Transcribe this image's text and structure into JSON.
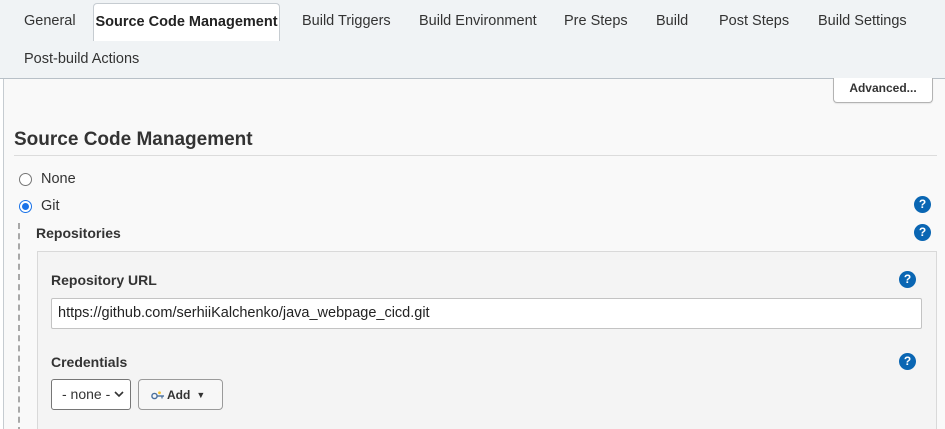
{
  "tabs": [
    {
      "label": "General",
      "active": false
    },
    {
      "label": "Source Code Management",
      "active": true
    },
    {
      "label": "Build Triggers",
      "active": false
    },
    {
      "label": "Build Environment",
      "active": false
    },
    {
      "label": "Pre Steps",
      "active": false
    },
    {
      "label": "Build",
      "active": false
    },
    {
      "label": "Post Steps",
      "active": false
    },
    {
      "label": "Build Settings",
      "active": false
    },
    {
      "label": "Post-build Actions",
      "active": false
    }
  ],
  "advanced_label": "Advanced...",
  "scm": {
    "title": "Source Code Management",
    "options": [
      {
        "label": "None",
        "selected": false
      },
      {
        "label": "Git",
        "selected": true
      }
    ],
    "repositories_label": "Repositories",
    "repository_url_label": "Repository URL",
    "repository_url_value": "https://github.com/serhiiKalchenko/java_webpage_cicd.git",
    "credentials_label": "Credentials",
    "credentials_selected": "- none -",
    "add_label": "Add"
  },
  "help_symbol": "?",
  "icons": [
    "help-icon",
    "key-icon",
    "caret-down-icon",
    "chevron-down-icon"
  ],
  "colors": {
    "help": "#0a66b3",
    "radio_selected": "#1a73e8"
  }
}
